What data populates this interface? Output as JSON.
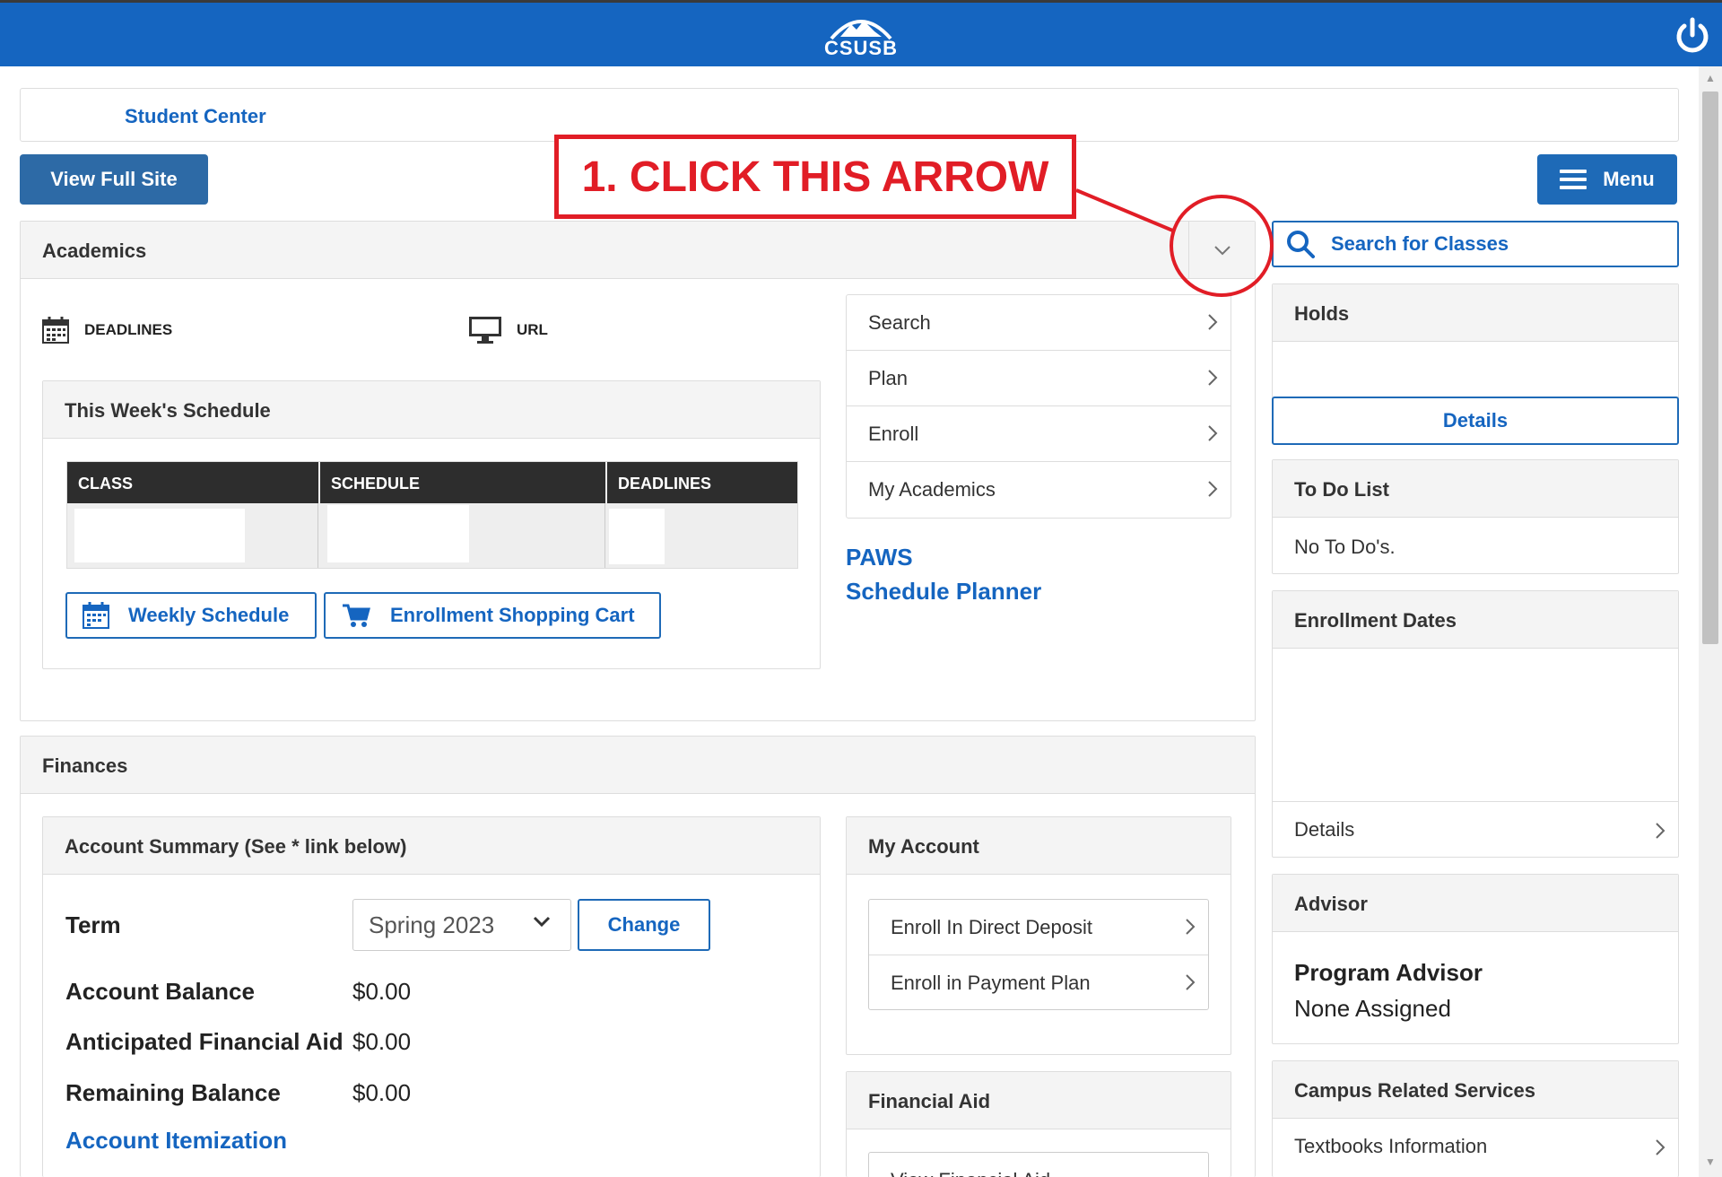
{
  "header": {
    "logo_text": "CSUSB"
  },
  "breadcrumb": {
    "label": "Student Center"
  },
  "buttons": {
    "view_full_site": "View Full Site",
    "menu": "Menu"
  },
  "annotation": {
    "text": "1. CLICK THIS ARROW",
    "color": "#e11d26"
  },
  "academics": {
    "title": "Academics",
    "deadlines_label": "DEADLINES",
    "url_label": "URL",
    "schedule": {
      "title": "This Week's Schedule",
      "columns": [
        "CLASS",
        "SCHEDULE",
        "DEADLINES"
      ]
    },
    "weekly_schedule": "Weekly Schedule",
    "shopping_cart": "Enrollment Shopping Cart",
    "nav": [
      "Search",
      "Plan",
      "Enroll",
      "My Academics"
    ],
    "links": [
      "PAWS",
      "Schedule Planner"
    ]
  },
  "search_classes": "Search for Classes",
  "holds": {
    "title": "Holds",
    "details": "Details"
  },
  "todo": {
    "title": "To Do List",
    "empty": "No To Do's."
  },
  "enrollment_dates": {
    "title": "Enrollment Dates",
    "details": "Details"
  },
  "advisor": {
    "title": "Advisor",
    "role": "Program Advisor",
    "name": "None Assigned"
  },
  "campus_services": {
    "title": "Campus Related Services",
    "item": "Textbooks Information"
  },
  "finances": {
    "title": "Finances",
    "account_summary": {
      "title": "Account Summary (See * link below)",
      "term_label": "Term",
      "term_value": "Spring 2023",
      "change": "Change",
      "rows": [
        {
          "label": "Account Balance",
          "value": "$0.00"
        },
        {
          "label": "Anticipated Financial Aid",
          "value": "$0.00"
        },
        {
          "label": "Remaining Balance",
          "value": "$0.00"
        }
      ],
      "itemization": "Account Itemization"
    },
    "my_account": {
      "title": "My Account",
      "links": [
        "Enroll In Direct Deposit",
        "Enroll in Payment Plan"
      ]
    },
    "financial_aid": {
      "title": "Financial Aid",
      "link": "View Financial Aid"
    }
  },
  "colors": {
    "brand_blue": "#1565c0",
    "header_gray": "#f4f4f4",
    "table_header": "#2d2d2d"
  }
}
